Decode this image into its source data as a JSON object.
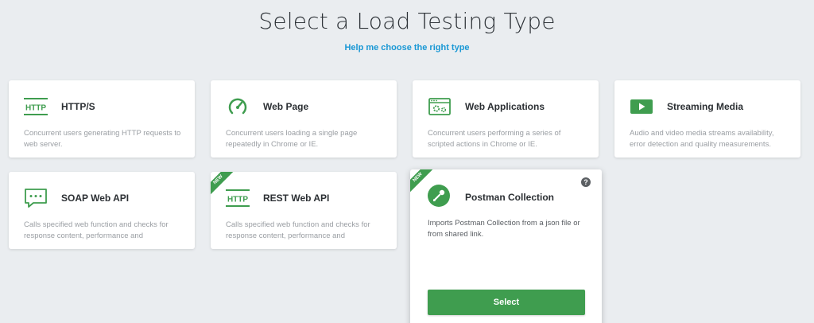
{
  "header": {
    "title": "Select a Load Testing Type",
    "help_link": "Help me choose the right type"
  },
  "accent_color": "#3f9d4f",
  "link_color": "#1a98d5",
  "cards": [
    {
      "title": "HTTP/S",
      "icon": "http-icon",
      "description": "Concurrent users generating HTTP requests to web server."
    },
    {
      "title": "Web Page",
      "icon": "speedometer-icon",
      "description": "Concurrent users loading a single page repeatedly in Chrome or IE."
    },
    {
      "title": "Web Applications",
      "icon": "web-app-gear-icon",
      "description": "Concurrent users performing a series of scripted actions in Chrome or IE."
    },
    {
      "title": "Streaming Media",
      "icon": "play-icon",
      "description": "Audio and video media streams availability, error detection and quality measurements."
    },
    {
      "title": "SOAP Web API",
      "icon": "chat-bubble-icon",
      "description": "Calls specified web function and checks for response content, performance and"
    },
    {
      "title": "REST Web API",
      "icon": "http-icon",
      "badge": "NEW",
      "description": "Calls specified web function and checks for response content, performance and"
    },
    {
      "title": "Postman Collection",
      "icon": "postman-icon",
      "badge": "NEW",
      "help": "?",
      "description": "Imports Postman Collection from a json file or from shared link.",
      "button": "Select"
    }
  ]
}
